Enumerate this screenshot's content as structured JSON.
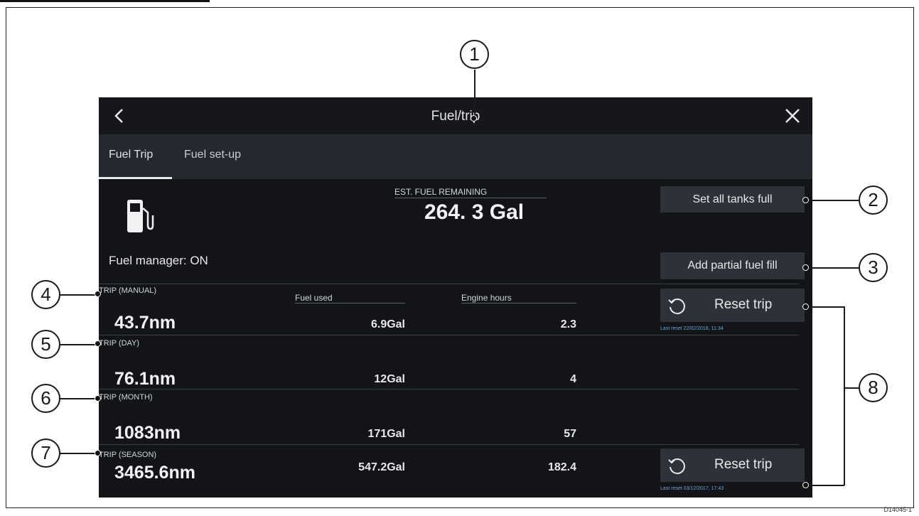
{
  "window": {
    "title": "Fuel/trip"
  },
  "tabs": [
    {
      "label": "Fuel Trip",
      "active": true
    },
    {
      "label": "Fuel set-up",
      "active": false
    }
  ],
  "fuel_manager": "Fuel manager:  ON",
  "estimate": {
    "label": "EST. FUEL REMAINING",
    "value": "264. 3 Gal"
  },
  "buttons": {
    "set_all_full": "Set all tanks full",
    "add_partial": "Add partial fuel fill",
    "reset_trip": "Reset trip"
  },
  "columns": {
    "fuel_used": "Fuel used",
    "engine_hours": "Engine hours"
  },
  "trips": [
    {
      "label": "TRIP (MANUAL)",
      "distance": "43.7nm",
      "fuel": "6.9Gal",
      "hours": "2.3",
      "last_reset": "Last reset 22/02/2018, 11:34"
    },
    {
      "label": "TRIP (DAY)",
      "distance": "76.1nm",
      "fuel": "12Gal",
      "hours": "4"
    },
    {
      "label": "TRIP (MONTH)",
      "distance": "1083nm",
      "fuel": "171Gal",
      "hours": "57"
    },
    {
      "label": "TRIP (SEASON)",
      "distance": "3465.6nm",
      "fuel": "547.2Gal",
      "hours": "182.4",
      "last_reset": "Last reset 03/12/2017, 17:43"
    }
  ],
  "callouts": [
    "1",
    "2",
    "3",
    "4",
    "5",
    "6",
    "7",
    "8"
  ],
  "figure_code": "D14045-1",
  "icons": {
    "back": "chevron-left-icon",
    "close": "close-icon",
    "pump": "fuel-pump-icon",
    "reset": "reset-icon"
  },
  "colors": {
    "screen_bg": "#121418",
    "tab_bar": "#23292f",
    "button_bg": "#2c3238",
    "last_reset_text": "#6fa6d6"
  }
}
